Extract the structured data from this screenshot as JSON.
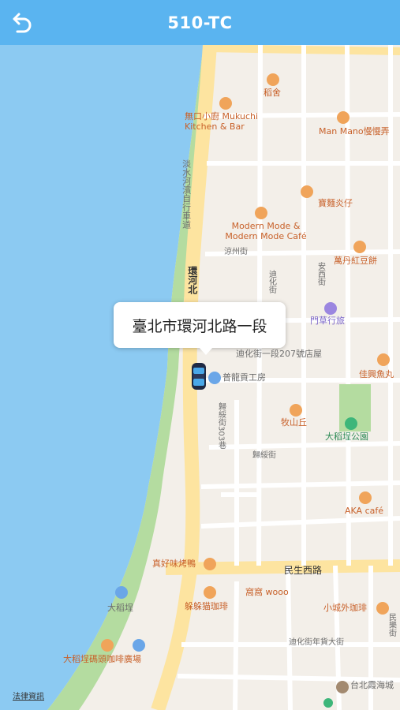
{
  "header": {
    "title": "510-TC",
    "back_icon": "back-arrow-icon"
  },
  "callout": {
    "text": "臺北市環河北路一段"
  },
  "map": {
    "labels": {
      "daocang": "稻舍",
      "mukuchi": "無口小廚 Mukuchi Kitchen & Bar",
      "manmano": "Man Mano慢慢弄",
      "bikepath": "淡水河濱自行車道",
      "baoyanyanzhi": "寶麵炎仔",
      "modernmode": "Modern Mode & Modern Mode Café",
      "liangzhou": "涼州街",
      "huanhe": "環河北",
      "dihua": "迪化街",
      "anxi": "安西街",
      "wandan": "萬丹紅豆餅",
      "mencao": "門草行旅",
      "dihua207": "迪化街一段207號店屋",
      "jiamei": "佳興魚丸",
      "pulong": "普龍貢工房",
      "muzhanqiu": "牧山丘",
      "guisui303": "歸綏街303巷",
      "dadaocheng_park": "大稻埕公園",
      "guisui": "歸綏街",
      "aka": "AKA café",
      "zhenhaowei": "真好味烤鴨",
      "minsheng": "民生西路",
      "wowo": "窩窩 wooo",
      "duoduo": "躲躲猫珈琲",
      "xiaocheng": "小城外珈琲",
      "dadaocheng": "大稻埕",
      "minle": "民樂街",
      "dihua_market": "迪化街年貨大街",
      "wharf": "大稻埕碼頭咖啡廣場",
      "xiahai": "台北霞海城"
    },
    "legal": "法律資訊"
  },
  "colors": {
    "header": "#5ab4f0",
    "water": "#8ccaf2",
    "park": "#b4dca0",
    "road_main": "#fde4a0",
    "poi": "#c8612a"
  }
}
